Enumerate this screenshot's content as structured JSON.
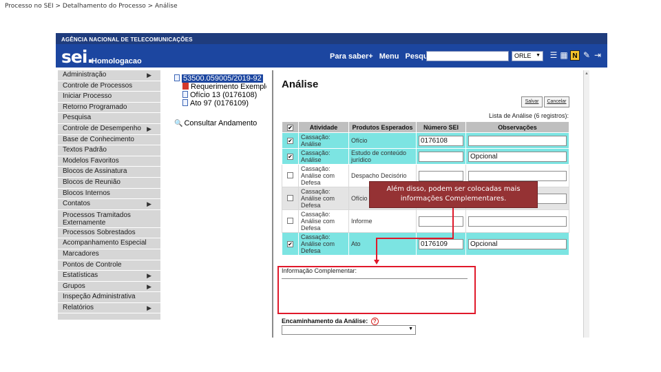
{
  "breadcrumb": "Processo no SEI > Detalhamento do Processo > Análise",
  "header": {
    "agency": "AGÊNCIA NACIONAL DE TELECOMUNICAÇÕES",
    "logo": "sei.",
    "environment": "Homologacao",
    "links": [
      "Para saber+",
      "Menu",
      "Pesquisa"
    ],
    "search_value": "",
    "unit": "ORLE",
    "unit_arrow": "▼",
    "icons": [
      "list-icon",
      "grid-icon",
      "notepad-icon",
      "tools-icon",
      "exit-icon"
    ]
  },
  "sidebar": {
    "items": [
      {
        "label": "Administração",
        "sub": true
      },
      {
        "label": "Controle de Processos",
        "sub": false
      },
      {
        "label": "Iniciar Processo",
        "sub": false
      },
      {
        "label": "Retorno Programado",
        "sub": false
      },
      {
        "label": "Pesquisa",
        "sub": false
      },
      {
        "label": "Controle de Desempenho",
        "sub": true
      },
      {
        "label": "Base de Conhecimento",
        "sub": false
      },
      {
        "label": "Textos Padrão",
        "sub": false
      },
      {
        "label": "Modelos Favoritos",
        "sub": false
      },
      {
        "label": "Blocos de Assinatura",
        "sub": false
      },
      {
        "label": "Blocos de Reunião",
        "sub": false
      },
      {
        "label": "Blocos Internos",
        "sub": false
      },
      {
        "label": "Contatos",
        "sub": true
      },
      {
        "label": "Processos Tramitados Externamente",
        "sub": false,
        "tall": true
      },
      {
        "label": "Processos Sobrestados",
        "sub": false
      },
      {
        "label": "Acompanhamento Especial",
        "sub": false
      },
      {
        "label": "Marcadores",
        "sub": false
      },
      {
        "label": "Pontos de Controle",
        "sub": false
      },
      {
        "label": "Estatísticas",
        "sub": true
      },
      {
        "label": "Grupos",
        "sub": true
      },
      {
        "label": "Inspeção Administrativa",
        "sub": false
      },
      {
        "label": "Relatórios",
        "sub": true
      }
    ],
    "chevron": "▶"
  },
  "tree": {
    "process": "53500.059005/2019-92",
    "documents": [
      {
        "label": "Requerimento Exemplo",
        "icon": "pdf"
      },
      {
        "label": "Ofício 13 (0176108)",
        "icon": "doc"
      },
      {
        "label": "Ato 97 (0176109)",
        "icon": "doc"
      }
    ],
    "consult": "Consultar Andamento"
  },
  "main": {
    "title": "Análise",
    "buttons": [
      "Salvar",
      "Cancelar"
    ],
    "list_caption": "Lista de Análise (6 registros):",
    "columns": [
      "Atividade",
      "Produtos Esperados",
      "Número SEI",
      "Observações"
    ],
    "rows": [
      {
        "checked": true,
        "activity": "Cassação: Análise",
        "product": "Ofício",
        "sei": "0176108",
        "obs": "",
        "style": "sel"
      },
      {
        "checked": true,
        "activity": "Cassação: Análise",
        "product": "Estudo de conteúdo jurídico",
        "sei": "",
        "obs": "Opcional",
        "style": "sel"
      },
      {
        "checked": false,
        "activity": "Cassação: Análise com Defesa",
        "product": "Despacho Decisório",
        "sei": "",
        "obs": "",
        "style": "wht"
      },
      {
        "checked": false,
        "activity": "Cassação: Análise com Defesa",
        "product": "Ofício",
        "sei": "",
        "obs": "",
        "style": "gry"
      },
      {
        "checked": false,
        "activity": "Cassação: Análise com Defesa",
        "product": "Informe",
        "sei": "",
        "obs": "",
        "style": "wht"
      },
      {
        "checked": true,
        "activity": "Cassação: Análise com Defesa",
        "product": "Ato",
        "sei": "0176109",
        "obs": "Opcional",
        "style": "sel"
      }
    ],
    "check_mark": "✔",
    "info_label": "Informação Complementar:",
    "enc_label": "Encaminhamento da Análise:",
    "help": "?",
    "enc_arrow": "▼"
  },
  "callout": {
    "line1": "Além disso, podem ser colocadas mais",
    "line2": "informações Complementares."
  },
  "colors": {
    "topbar": "#1c46a0",
    "selected_row": "#7ce4e2",
    "callout": "#953234",
    "highlight": "#e0182a"
  }
}
